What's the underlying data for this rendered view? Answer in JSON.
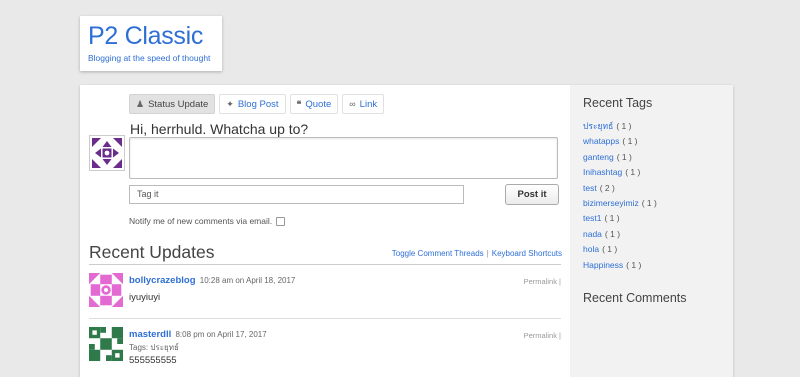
{
  "site": {
    "title": "P2 Classic",
    "description": "Blogging at the speed of thought"
  },
  "post_form": {
    "tabs": [
      {
        "label": "Status Update",
        "icon": "user-icon",
        "active": true
      },
      {
        "label": "Blog Post",
        "icon": "pin-icon",
        "active": false
      },
      {
        "label": "Quote",
        "icon": "quote-icon",
        "active": false
      },
      {
        "label": "Link",
        "icon": "link-icon",
        "active": false
      }
    ],
    "prompt": "Hi, herrhuld. Whatcha up to?",
    "textarea_value": "",
    "tag_placeholder": "Tag it",
    "post_button": "Post it",
    "notify_label": "Notify me of new comments via email.",
    "notify_checked": false
  },
  "recent": {
    "title": "Recent Updates",
    "toggle_link": "Toggle Comment Threads",
    "separator": "|",
    "shortcuts_link": "Keyboard Shortcuts",
    "updates": [
      {
        "author": "bollycrazeblog",
        "time": "10:28 am on April 18, 2017",
        "permalink": "Permalink |",
        "tags_label": "",
        "body": "iyuyiuyi",
        "avatar_color": "#e36ad2"
      },
      {
        "author": "masterdll",
        "time": "8:08 pm on April 17, 2017",
        "permalink": "Permalink |",
        "tags_label": "Tags: ประยุทธ์",
        "body": "555555555",
        "avatar_color": "#2f7a4a"
      }
    ]
  },
  "sidebar": {
    "tags_title": "Recent Tags",
    "tags": [
      {
        "name": "ประยุทธ์",
        "count": "( 1 )"
      },
      {
        "name": "whatapps",
        "count": "( 1 )"
      },
      {
        "name": "ganteng",
        "count": "( 1 )"
      },
      {
        "name": "Inihashtag",
        "count": "( 1 )"
      },
      {
        "name": "test",
        "count": "( 2 )"
      },
      {
        "name": "bizimerseyimiz",
        "count": "( 1 )"
      },
      {
        "name": "test1",
        "count": "( 1 )"
      },
      {
        "name": "nada",
        "count": "( 1 )"
      },
      {
        "name": "hola",
        "count": "( 1 )"
      },
      {
        "name": "Happiness",
        "count": "( 1 )"
      }
    ],
    "comments_title": "Recent Comments"
  },
  "colors": {
    "link": "#2e6fd6",
    "current_user_avatar": "#6a2d8c"
  }
}
